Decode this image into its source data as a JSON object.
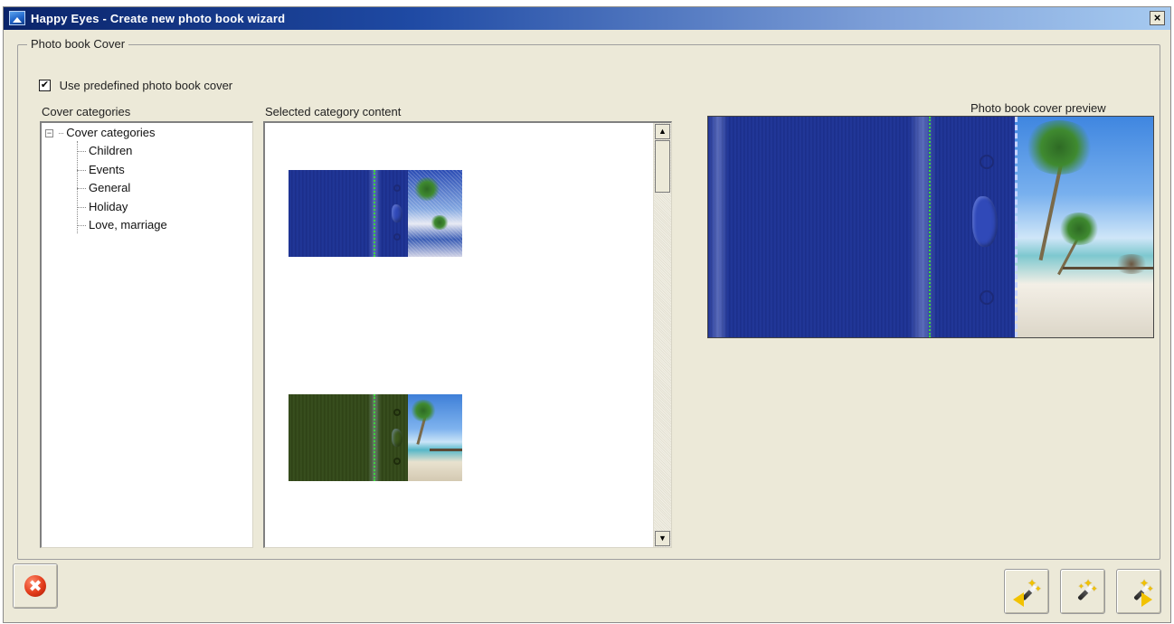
{
  "window": {
    "title": "Happy Eyes - Create new photo book wizard",
    "close_label": "×"
  },
  "group": {
    "legend": "Photo book Cover",
    "checkbox_label": "Use predefined photo book cover",
    "checkbox_checked": true,
    "checkbox_mark": "✔"
  },
  "categories": {
    "label": "Cover categories",
    "tree": {
      "root": "Cover categories",
      "expander": "−",
      "children": [
        "Children",
        "Events",
        "General",
        "Holiday",
        "Love, marriage"
      ]
    }
  },
  "content": {
    "label": "Selected category content",
    "thumbnails": [
      {
        "cover_color": "blue"
      },
      {
        "cover_color": "green"
      }
    ],
    "scroll_up": "▲",
    "scroll_down": "▼"
  },
  "preview": {
    "label": "Photo book cover preview"
  },
  "buttons": {
    "cancel_icon": "✖",
    "back_icon": "magic-wand-back-icon",
    "wizard_icon": "magic-wand-icon",
    "next_icon": "magic-wand-next-icon"
  },
  "colors": {
    "titlebar_start": "#0a246a",
    "titlebar_end": "#a6caf0",
    "dialog_bg": "#ece9d8",
    "cover_blue": "#1b2f8c",
    "cover_green": "#2f4416",
    "stitch_green": "#3dd63d",
    "cancel_red": "#e23b1a"
  }
}
